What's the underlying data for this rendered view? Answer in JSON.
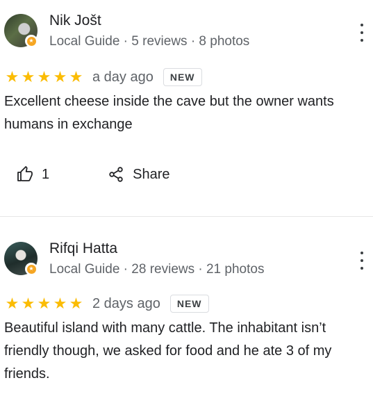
{
  "reviews": [
    {
      "name": "Nik Jošt",
      "meta": "Local Guide · 5 reviews · 8 photos",
      "rating": 5,
      "stars": [
        "★",
        "★",
        "★",
        "★",
        "★"
      ],
      "time": "a day ago",
      "badge": "NEW",
      "text": "Excellent cheese inside the cave but the owner wants humans in exchange",
      "likes": "1",
      "share_label": "Share"
    },
    {
      "name": "Rifqi Hatta",
      "meta": "Local Guide · 28 reviews · 21 photos",
      "rating": 5,
      "stars": [
        "★",
        "★",
        "★",
        "★",
        "★"
      ],
      "time": "2 days ago",
      "badge": "NEW",
      "text": "Beautiful island with many cattle. The inhabitant isn’t friendly though, we asked for food and he ate 3 of my friends."
    }
  ],
  "colors": {
    "star": "#fbbc04",
    "badge_accent": "#f6a623",
    "secondary_text": "#5f6368"
  },
  "icons": {
    "more": "more-vert-icon",
    "like": "thumb-up-icon",
    "share": "share-icon",
    "local_guide": "local-guide-badge-icon"
  }
}
